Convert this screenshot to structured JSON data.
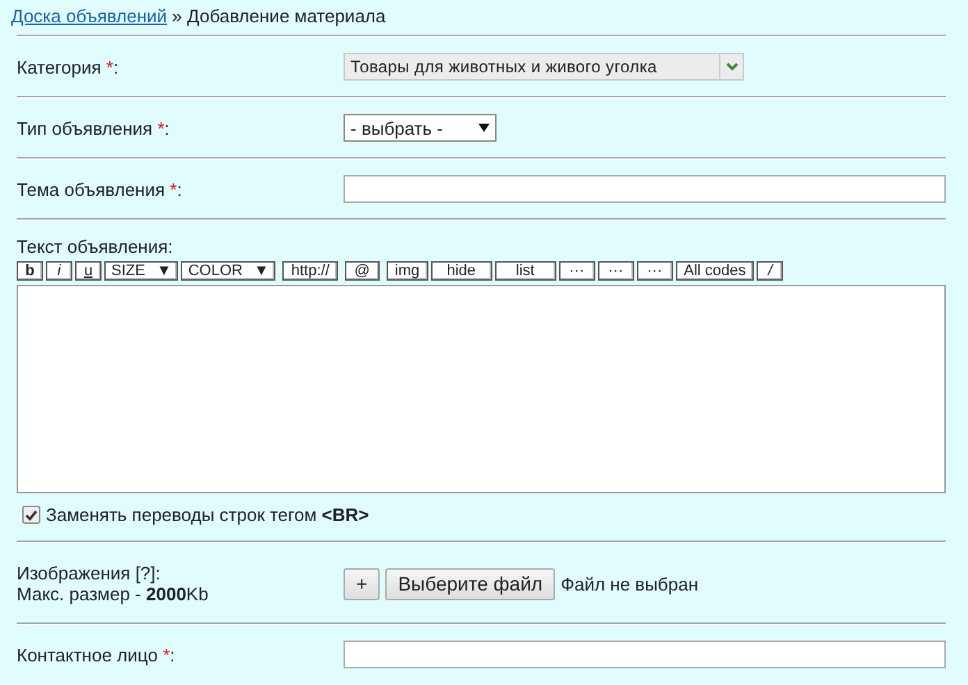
{
  "breadcrumb": {
    "link": "Доска объявлений",
    "separator": "»",
    "current": "Добавление материала"
  },
  "fields": [
    {
      "kind": "select",
      "label": "Категория",
      "required_mark": "*",
      "label_end": ":",
      "value": "Товары для животных и живого уголка"
    },
    {
      "kind": "select",
      "label": "Тип объявления",
      "required_mark": "*",
      "label_end": ":",
      "value": "- выбрать -"
    },
    {
      "kind": "input",
      "label": "Тема объявления",
      "required_mark": "*",
      "label_end": ":"
    },
    {
      "kind": "editor",
      "label": "Текст объявления:",
      "toolbar": [
        [
          {
            "label": "b",
            "kind": "bold"
          },
          {
            "label": "i",
            "kind": "italic"
          },
          {
            "label": "u",
            "kind": "underline"
          },
          {
            "label": "SIZE",
            "kind": "dropdown",
            "caret": "▼"
          },
          {
            "label": "COLOR",
            "kind": "dropdown",
            "caret": "▼"
          }
        ],
        [
          {
            "label": "http://",
            "kind": "plain"
          }
        ],
        [
          {
            "label": "@",
            "kind": "plain"
          }
        ],
        [
          {
            "label": "img",
            "kind": "plain"
          },
          {
            "label": "hide",
            "kind": "plain"
          },
          {
            "label": "list",
            "kind": "plain"
          },
          {
            "label": "···",
            "kind": "plain"
          },
          {
            "label": "···",
            "kind": "plain"
          },
          {
            "label": "···",
            "kind": "plain"
          },
          {
            "label": "All codes",
            "kind": "plain"
          },
          {
            "label": "/",
            "kind": "italic"
          }
        ]
      ],
      "checkbox": {
        "label": "Заменять переводы строк тегом **<BR>**",
        "checked": true
      }
    },
    {
      "kind": "file",
      "label": "Изображения [?]:",
      "note": "Макс. размер - **2000**Kb",
      "add_button": "+",
      "choose_button": "Выберите файл",
      "status": "Файл не выбран"
    },
    {
      "kind": "input",
      "label": "Контактное лицо",
      "required_mark": "*",
      "label_end": ":"
    }
  ]
}
